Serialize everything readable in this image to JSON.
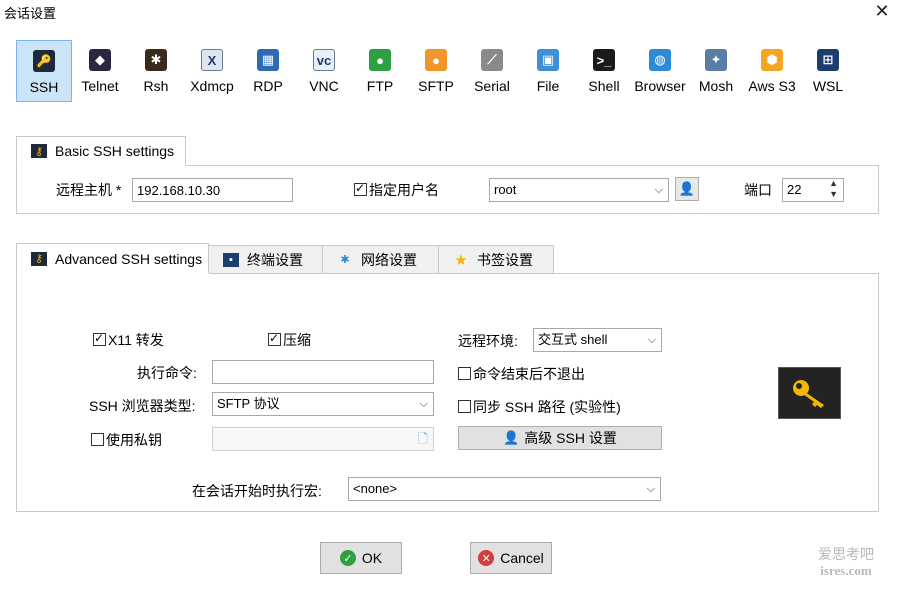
{
  "window": {
    "title": "会话设置",
    "close_glyph": "✕"
  },
  "protocols": [
    {
      "label": "SSH",
      "icon": "ssh-key-icon",
      "color": "#1e2a3a",
      "glyph": "🔑",
      "selected": true
    },
    {
      "label": "Telnet",
      "icon": "telnet-icon",
      "color": "#2d2640",
      "glyph": "◆"
    },
    {
      "label": "Rsh",
      "icon": "rsh-icon",
      "color": "#3a2a1a",
      "glyph": "✱"
    },
    {
      "label": "Xdmcp",
      "icon": "xdmcp-icon",
      "color": "#dfe6ef",
      "glyph": "X"
    },
    {
      "label": "RDP",
      "icon": "rdp-icon",
      "color": "#2d6bb5",
      "glyph": "▦"
    },
    {
      "label": "VNC",
      "icon": "vnc-icon",
      "color": "#e8f0f7",
      "glyph": "vc"
    },
    {
      "label": "FTP",
      "icon": "ftp-icon",
      "color": "#2ea043",
      "glyph": "●"
    },
    {
      "label": "SFTP",
      "icon": "sftp-icon",
      "color": "#f0962a",
      "glyph": "●"
    },
    {
      "label": "Serial",
      "icon": "serial-plug-icon",
      "color": "#8a8a8a",
      "glyph": "⟋"
    },
    {
      "label": "File",
      "icon": "file-monitor-icon",
      "color": "#3f8fd6",
      "glyph": "▣"
    },
    {
      "label": "Shell",
      "icon": "shell-terminal-icon",
      "color": "#1a1a1a",
      "glyph": ">_"
    },
    {
      "label": "Browser",
      "icon": "browser-globe-icon",
      "color": "#2d8bd6",
      "glyph": "◍"
    },
    {
      "label": "Mosh",
      "icon": "mosh-antenna-icon",
      "color": "#5a7da6",
      "glyph": "✦"
    },
    {
      "label": "Aws S3",
      "icon": "aws-s3-icon",
      "color": "#f5a623",
      "glyph": "⬢"
    },
    {
      "label": "WSL",
      "icon": "wsl-windows-icon",
      "color": "#1d3c6e",
      "glyph": "⊞"
    }
  ],
  "basic": {
    "tab_label": "Basic SSH settings",
    "host_label": "远程主机 *",
    "host_value": "192.168.10.30",
    "specify_user_label": "指定用户名",
    "specify_user_checked": true,
    "username_value": "root",
    "port_label": "端口",
    "port_value": "22"
  },
  "advanced_tabs": [
    {
      "label": "Advanced SSH settings",
      "icon": "key-icon",
      "active": true
    },
    {
      "label": "终端设置",
      "icon": "terminal-settings-icon"
    },
    {
      "label": "网络设置",
      "icon": "network-settings-icon"
    },
    {
      "label": "书签设置",
      "icon": "bookmark-star-icon"
    }
  ],
  "advanced": {
    "x11_label": "X11 转发",
    "x11_checked": true,
    "compress_label": "压缩",
    "compress_checked": true,
    "remote_env_label": "远程环境:",
    "remote_env_value": "交互式 shell",
    "exec_cmd_label": "执行命令:",
    "exec_cmd_value": "",
    "no_exit_label": "命令结束后不退出",
    "no_exit_checked": false,
    "browser_type_label": "SSH 浏览器类型:",
    "browser_type_value": "SFTP 协议",
    "sync_path_label": "同步  SSH 路径 (实验性)",
    "sync_path_checked": false,
    "private_key_label": "使用私钥",
    "private_key_checked": false,
    "private_key_value": "",
    "advanced_ssh_button": "高级 SSH 设置",
    "macro_label": "在会话开始时执行宏:",
    "macro_value": "<none>"
  },
  "footer": {
    "ok_label": "OK",
    "cancel_label": "Cancel"
  },
  "watermark": {
    "line1": "爱思考吧",
    "line2": "isres.com"
  },
  "colors": {
    "selected_bg": "#cce4f7",
    "ok_green": "#2ea043",
    "cancel_red": "#d83b3b",
    "key_yellow": "#f2b705"
  }
}
